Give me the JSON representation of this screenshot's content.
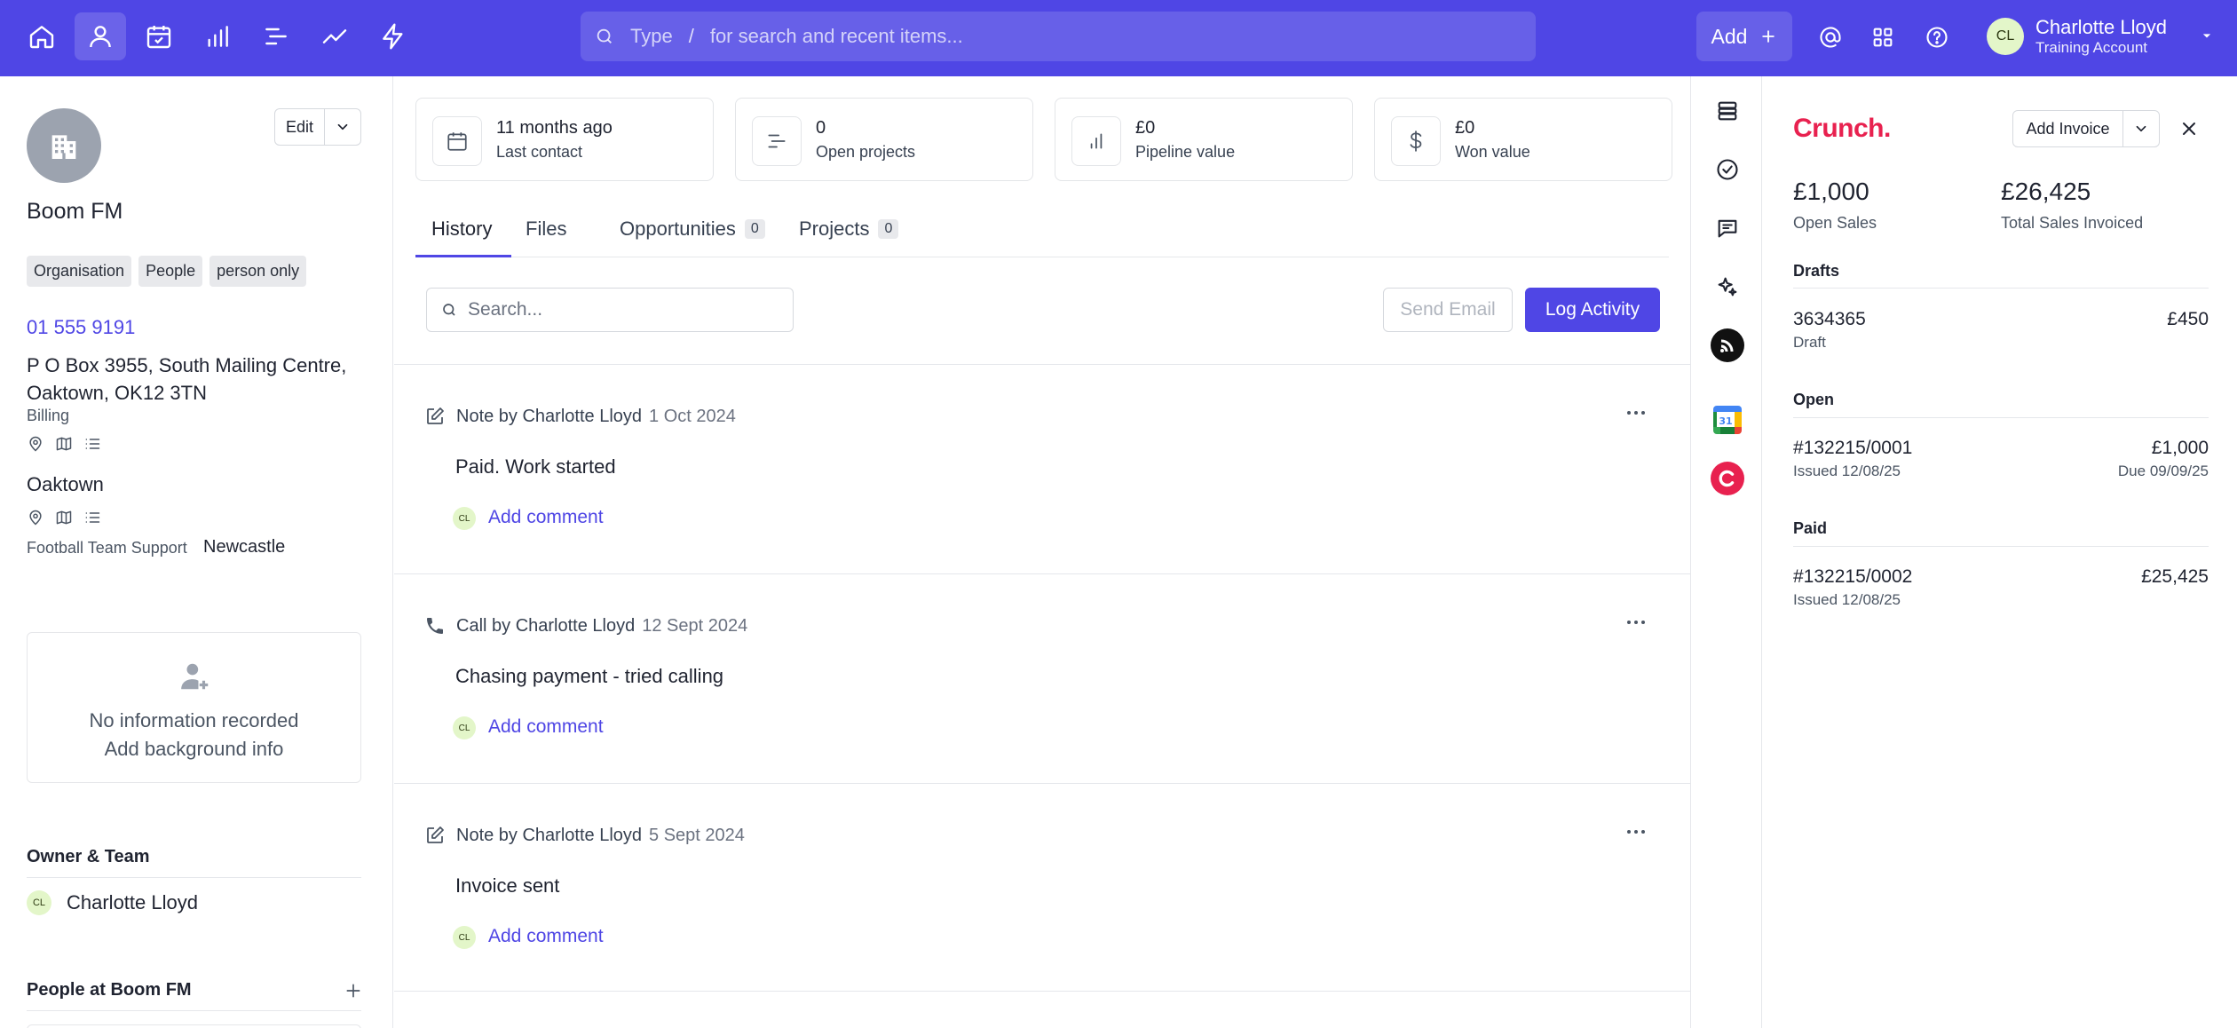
{
  "search": {
    "placeholder_prefix": "Type",
    "slash": "/",
    "placeholder_suffix": "for search and recent items..."
  },
  "topbar": {
    "add_label": "Add"
  },
  "user": {
    "initials": "CL",
    "name": "Charlotte Lloyd",
    "account": "Training Account"
  },
  "org": {
    "name": "Boom FM",
    "edit_label": "Edit",
    "tags": [
      "Organisation",
      "People",
      "person only"
    ],
    "phone": "01 555 9191",
    "address_line1": "P O Box 3955, South Mailing Centre,",
    "address_line2": "Oaktown, OK12 3TN",
    "address_type": "Billing",
    "town": "Oaktown",
    "custom_field_label": "Football Team Support",
    "custom_field_value": "Newcastle",
    "background_empty": "No information recorded",
    "background_add": "Add background info",
    "owner_title": "Owner & Team",
    "owner_initials": "CL",
    "owner_name": "Charlotte Lloyd",
    "people_title": "People at Boom FM"
  },
  "stats": [
    {
      "value": "11 months ago",
      "label": "Last contact",
      "icon": "calendar-icon"
    },
    {
      "value": "0",
      "label": "Open projects",
      "icon": "projects-icon"
    },
    {
      "value": "£0",
      "label": "Pipeline value",
      "icon": "bar-chart-icon"
    },
    {
      "value": "£0",
      "label": "Won value",
      "icon": "dollar-icon"
    }
  ],
  "tabs": [
    {
      "label": "History",
      "active": true
    },
    {
      "label": "Files"
    },
    {
      "label": "Opportunities",
      "count": "0"
    },
    {
      "label": "Projects",
      "count": "0"
    }
  ],
  "activity": {
    "search_placeholder": "Search...",
    "send_email": "Send Email",
    "log_activity": "Log Activity",
    "items": [
      {
        "type": "note",
        "by": "Note by Charlotte Lloyd",
        "date": "1 Oct 2024",
        "body": "Paid. Work started",
        "initials": "CL",
        "comment": "Add comment"
      },
      {
        "type": "call",
        "by": "Call by Charlotte Lloyd",
        "date": "12 Sept 2024",
        "body": "Chasing payment - tried calling",
        "initials": "CL",
        "comment": "Add comment"
      },
      {
        "type": "note",
        "by": "Note by Charlotte Lloyd",
        "date": "5 Sept 2024",
        "body": "Invoice sent",
        "initials": "CL",
        "comment": "Add comment"
      }
    ]
  },
  "strip": {
    "calendar_day": "31"
  },
  "crunch": {
    "logo": "Crunch.",
    "add_invoice": "Add Invoice",
    "open_sales": "£1,000",
    "open_sales_label": "Open Sales",
    "total_invoiced": "£26,425",
    "total_invoiced_label": "Total Sales Invoiced",
    "drafts_title": "Drafts",
    "draft": {
      "number": "3634365",
      "status": "Draft",
      "amount": "£450"
    },
    "open_title": "Open",
    "open_invoice": {
      "number": "#132215/0001",
      "issued": "Issued 12/08/25",
      "amount": "£1,000",
      "due": "Due 09/09/25"
    },
    "paid_title": "Paid",
    "paid_invoice": {
      "number": "#132215/0002",
      "issued": "Issued 12/08/25",
      "amount": "£25,425"
    }
  },
  "colors": {
    "brand": "#4f46e5",
    "crunch": "#e8214f"
  }
}
